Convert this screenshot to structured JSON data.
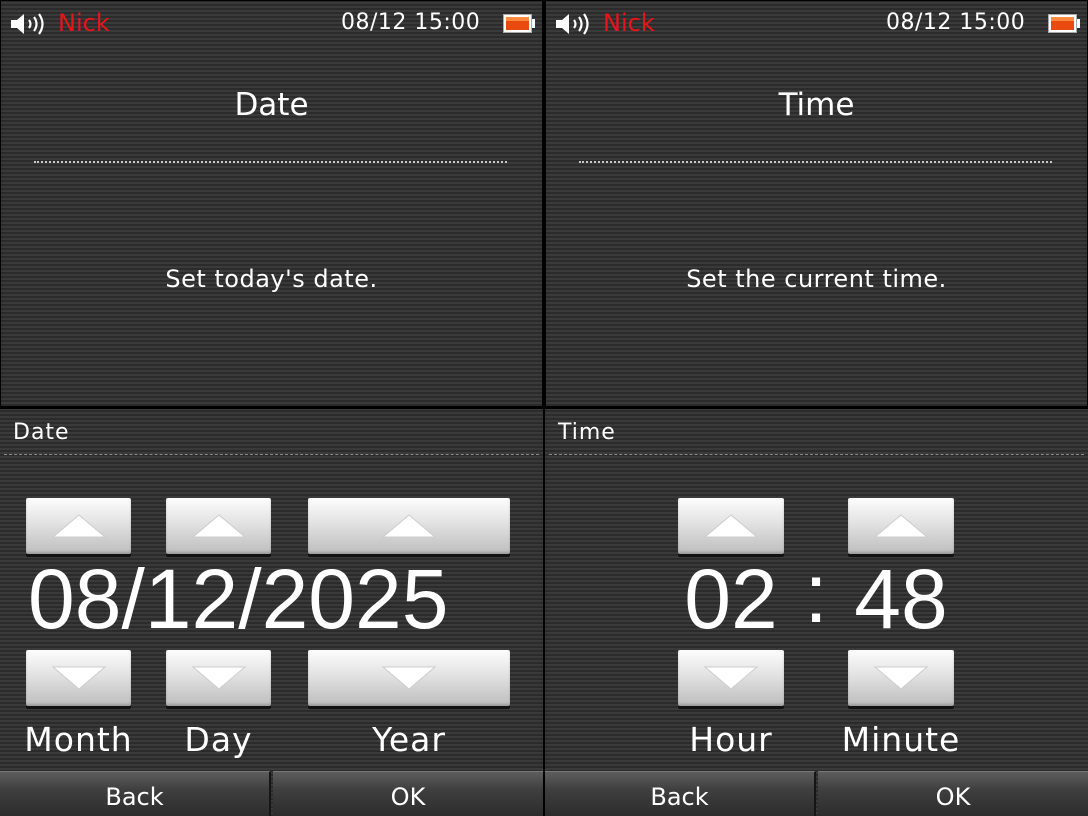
{
  "status": {
    "user_name": "Nick",
    "datetime": "08/12  15:00",
    "speaker_icon": "speaker-volume-icon",
    "battery_icon": "battery-icon",
    "user_color": "#e8141c",
    "battery_color": "#e84a10"
  },
  "date_screen": {
    "title": "Date",
    "message": "Set today's date.",
    "section_label": "Date",
    "month": "08",
    "day": "12",
    "year": "2025",
    "separator": "/",
    "labels": {
      "month": "Month",
      "day": "Day",
      "year": "Year"
    },
    "back_label": "Back",
    "ok_label": "OK"
  },
  "time_screen": {
    "title": "Time",
    "message": "Set the current time.",
    "section_label": "Time",
    "hour": "02",
    "minute": "48",
    "separator": ":",
    "labels": {
      "hour": "Hour",
      "minute": "Minute"
    },
    "back_label": "Back",
    "ok_label": "OK"
  }
}
